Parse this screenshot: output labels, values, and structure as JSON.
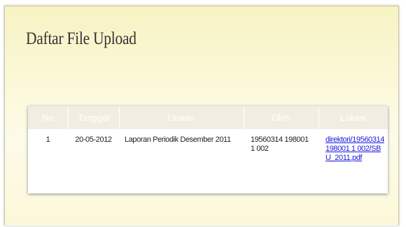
{
  "page": {
    "title": "Daftar File Upload"
  },
  "table": {
    "headers": [
      "No",
      "Tanggal",
      "Uraian",
      "Oleh",
      "Lokasi"
    ],
    "rows": [
      {
        "no": "1",
        "tanggal": "20-05-2012",
        "uraian": "Laporan Periodik Desember 2011",
        "oleh": "19560314 198001 1 002",
        "lokasi": "direktori/19560314 198001 1 002/SBU_2011.pdf"
      }
    ]
  },
  "colors": {
    "panel_bg": "#f7f3c2",
    "header_bg": "#f2ede2",
    "header_text": "#ffffff",
    "link": "#1a1adb"
  }
}
